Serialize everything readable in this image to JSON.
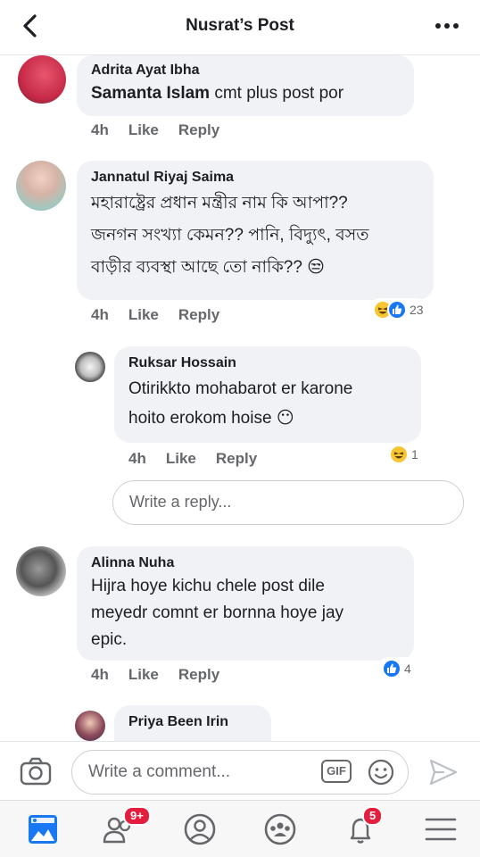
{
  "header": {
    "title": "Nusrat’s Post"
  },
  "comments": [
    {
      "author": "Adrita Ayat Ibha",
      "mention": "Samanta Islam",
      "text": " cmt plus post por",
      "time": "4h",
      "like": "Like",
      "reply": "Reply"
    },
    {
      "author": "Jannatul Riyaj Saima",
      "lines": [
        "মহারাষ্ট্রের প্রধান মন্ত্রীর নাম কি আপা??",
        "জনগন সংখ্যা কেমন?? পানি, বিদ্যুৎ,  বসত",
        "বাড়ীর ব্যবস্থা আছে তো নাকি?? 😒"
      ],
      "time": "4h",
      "like": "Like",
      "reply": "Reply",
      "reaction_count": "23"
    },
    {
      "author": "Ruksar Hossain",
      "lines": [
        "Otirikkto mohabarot er karone",
        "hoito erokom hoise 😶"
      ],
      "time": "4h",
      "like": "Like",
      "reply": "Reply",
      "reaction_count": "1"
    },
    {
      "author": "Alinna Nuha",
      "lines": [
        "Hijra hoye kichu chele post dile",
        "meyedr comnt er bornna hoye jay",
        "epic."
      ],
      "time": "4h",
      "like": "Like",
      "reply": "Reply",
      "reaction_count": "4"
    },
    {
      "author": "Priya Been Irin"
    }
  ],
  "reply_box": {
    "placeholder": "Write a reply..."
  },
  "composer": {
    "placeholder": "Write a comment...",
    "gif_label": "GIF"
  },
  "tabs": {
    "friends_badge": "9+",
    "notifications_badge": "5"
  },
  "colors": {
    "accent": "#1877f2",
    "badge": "#e41e3f",
    "bubble": "#f0f2f5"
  }
}
